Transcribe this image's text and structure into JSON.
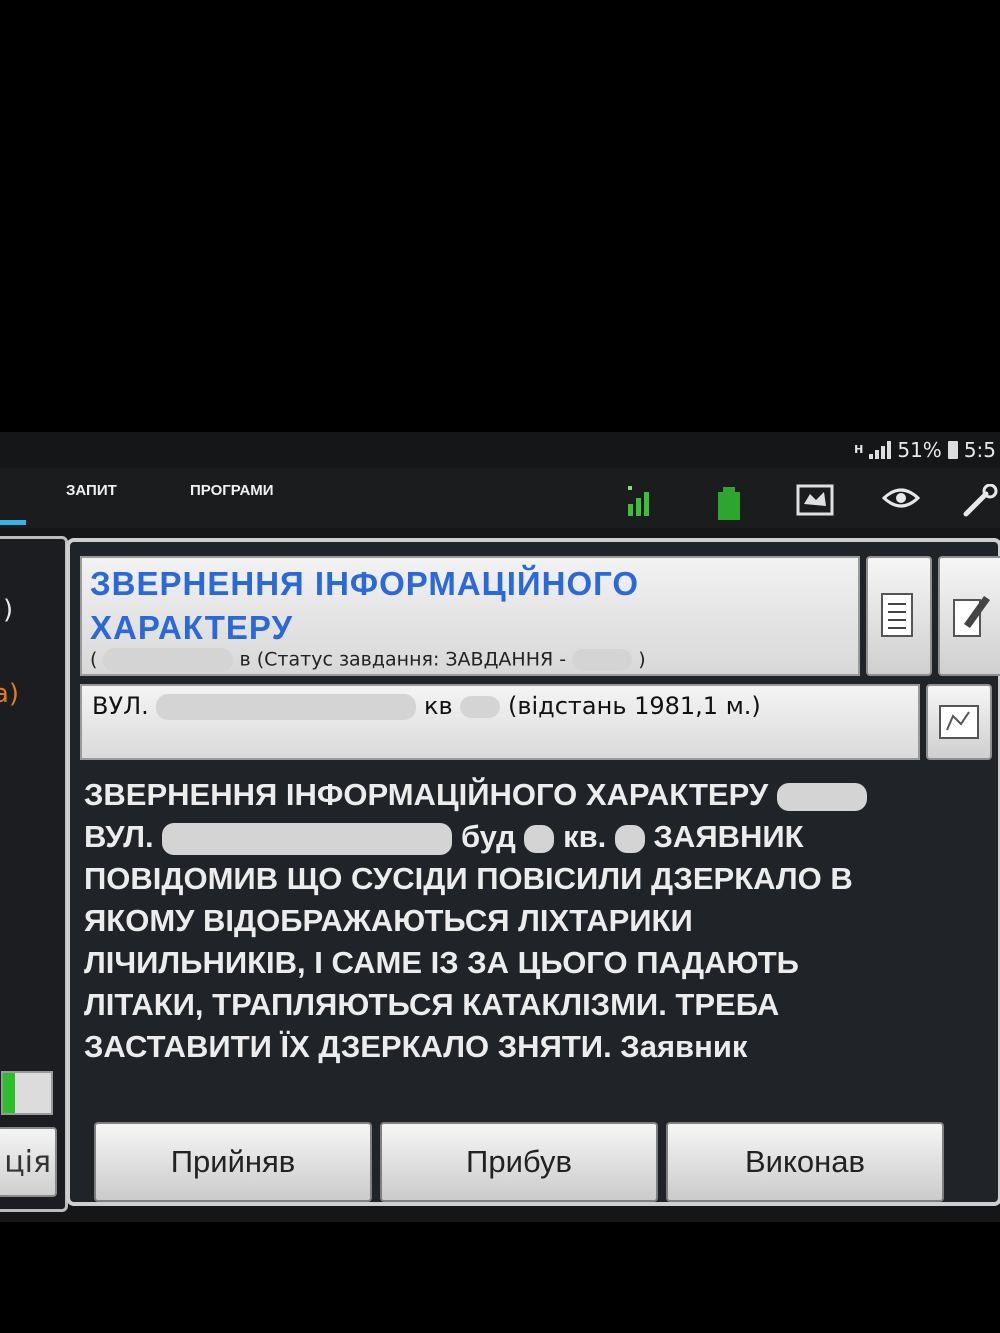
{
  "status_bar": {
    "network": "H",
    "battery": "51%",
    "time": "5:5"
  },
  "tabs": [
    {
      "label": "ЗАПИТ"
    },
    {
      "label": "ПРОГРАМИ"
    }
  ],
  "left_panel": {
    "fragment_1": ")",
    "fragment_2": "a)",
    "button_fragment": "ція",
    "progress": 0.25
  },
  "task": {
    "title": "ЗВЕРНЕННЯ ІНФОРМАЦІЙНОГО ХАРАКТЕРУ",
    "status_prefix": "(",
    "status_text": "в (Статус завдання: ЗАВДАННЯ -",
    "status_suffix": ")"
  },
  "address": {
    "street_label": "ВУЛ.",
    "apt_label": "кв",
    "distance": "(відстань 1981,1 м.)"
  },
  "description": {
    "line1": "ЗВЕРНЕННЯ ІНФОРМАЦІЙНОГО ХАРАКТЕРУ",
    "line2_a": "ВУЛ.",
    "line2_b": "буд",
    "line2_c": "кв.",
    "line2_d": "ЗАЯВНИК",
    "line3": "ПОВІДОМИВ ЩО СУСІДИ ПОВІСИЛИ ДЗЕРКАЛО В",
    "line4": "ЯКОМУ ВІДОБРАЖАЮТЬСЯ ЛІХТАРИКИ",
    "line5": "ЛІЧИЛЬНИКІВ, І САМЕ ІЗ ЗА ЦЬОГО ПАДАЮТЬ",
    "line6": "ЛІТАКИ, ТРАПЛЯЮТЬСЯ КАТАКЛІЗМИ. ТРЕБА",
    "line7": "ЗАСТАВИТИ ЇХ ДЗЕРКАЛО ЗНЯТИ. Заявник"
  },
  "buttons": {
    "accepted": "Прийняв",
    "arrived": "Прибув",
    "done": "Виконав"
  },
  "colors": {
    "title_blue": "#2b69d8",
    "signal_green": "#3dbf3d",
    "tab_indicator": "#33b5e5",
    "left_orange": "#e07a1a"
  },
  "icons": [
    "signal-strength-icon",
    "battery-block-icon",
    "map-icon",
    "eye-icon",
    "wrench-icon",
    "list-icon",
    "edit-note-icon",
    "map-location-icon"
  ]
}
